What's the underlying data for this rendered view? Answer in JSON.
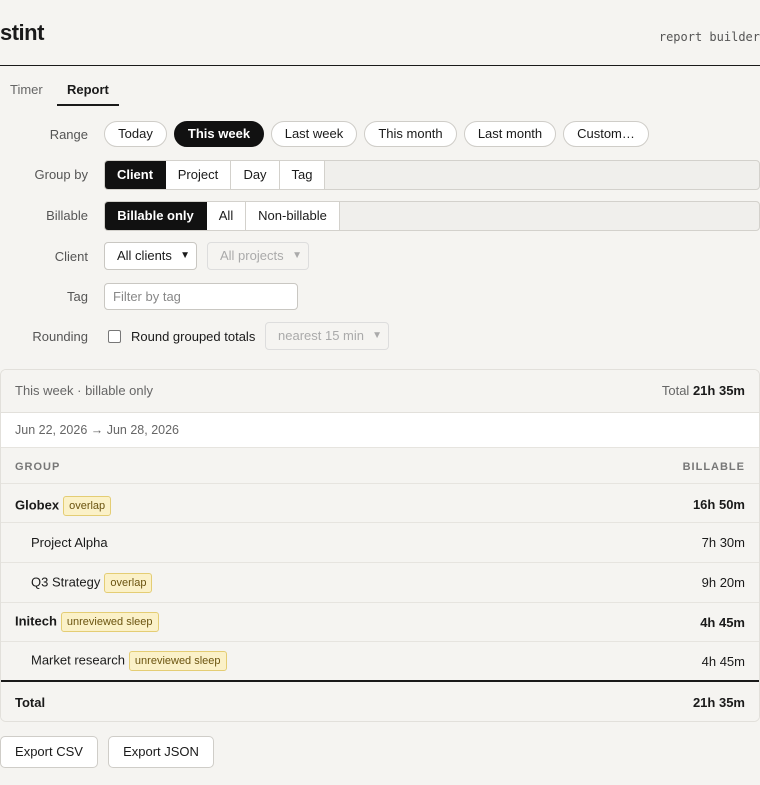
{
  "app": {
    "title": "stint",
    "subtitle": "report builder"
  },
  "tabs": [
    {
      "label": "Timer"
    },
    {
      "label": "Report"
    }
  ],
  "filters": {
    "range": {
      "label": "Range",
      "options": [
        "Today",
        "This week",
        "Last week",
        "This month",
        "Last month",
        "Custom…"
      ],
      "selected": "This week"
    },
    "group_by": {
      "label": "Group by",
      "options": [
        "Client",
        "Project",
        "Day",
        "Tag"
      ],
      "selected": "Client"
    },
    "billable": {
      "label": "Billable",
      "options": [
        "Billable only",
        "All",
        "Non-billable"
      ],
      "selected": "Billable only"
    },
    "client": {
      "label": "Client",
      "client_value": "All clients",
      "project_value": "All projects"
    },
    "tag": {
      "label": "Tag",
      "placeholder": "Filter by tag"
    },
    "rounding": {
      "label": "Rounding",
      "checkbox_label": "Round grouped totals",
      "checked": false,
      "select_value": "nearest 15 min"
    }
  },
  "report": {
    "summary": "This week · billable only",
    "total_label": "Total",
    "total_value": "21h 35m",
    "date_range": "Jun 22, 2026 → Jun 28, 2026",
    "columns": {
      "group": "GROUP",
      "billable": "BILLABLE"
    },
    "rows": [
      {
        "name": "Globex",
        "badge": "overlap",
        "value": "16h 50m"
      },
      {
        "name": "Project Alpha",
        "badge": "",
        "value": "7h 30m"
      },
      {
        "name": "Q3 Strategy",
        "badge": "overlap",
        "value": "9h 20m"
      },
      {
        "name": "Initech",
        "badge": "unreviewed sleep",
        "value": "4h 45m"
      },
      {
        "name": "Market research",
        "badge": "unreviewed sleep",
        "value": "4h 45m"
      }
    ],
    "footer": {
      "label": "Total",
      "value": "21h 35m"
    }
  },
  "actions": {
    "export_csv": "Export CSV",
    "export_json": "Export JSON"
  },
  "colors": {
    "accent": "#111111",
    "badge_bg": "#fbf1c8",
    "badge_border": "#e4cd74",
    "background": "#f5f4f1"
  }
}
